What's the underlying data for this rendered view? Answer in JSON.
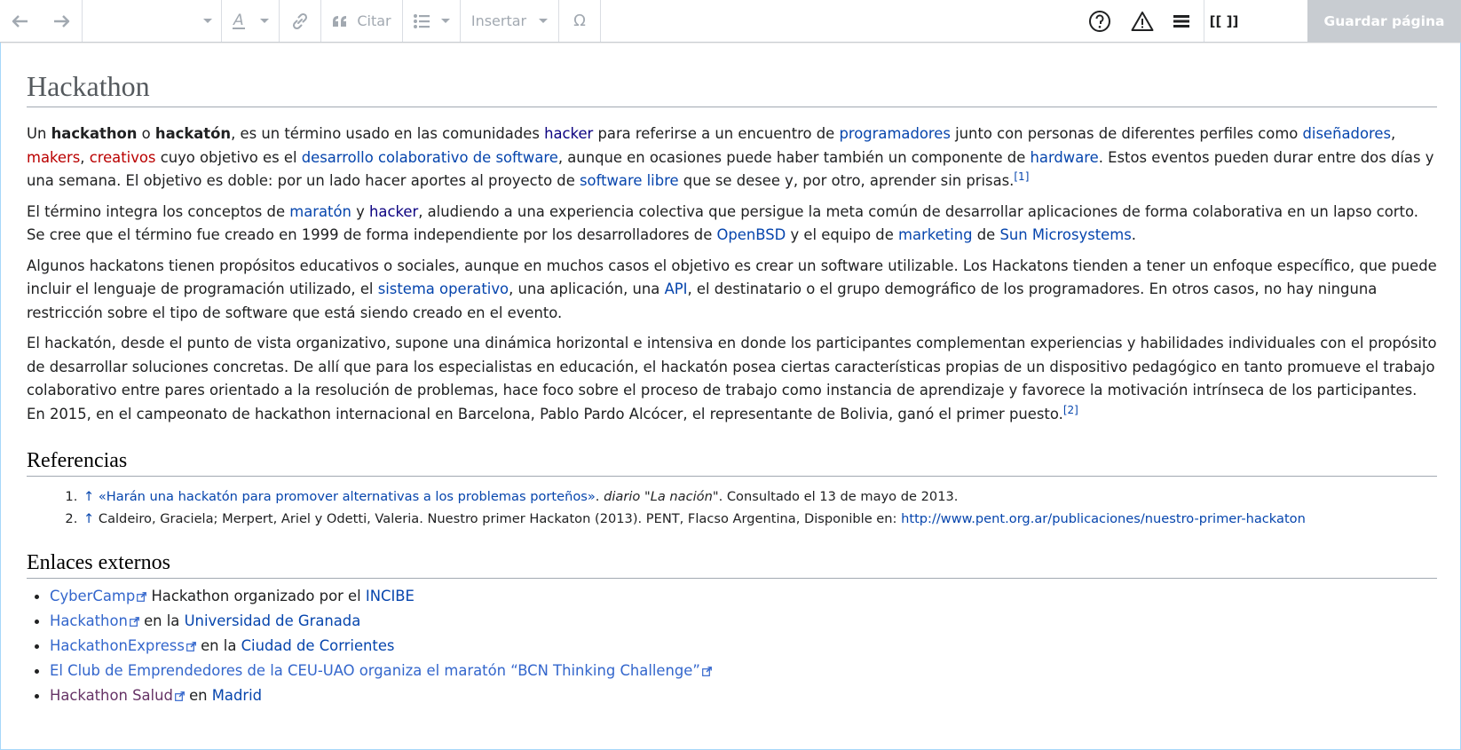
{
  "toolbar": {
    "undo_icon": "undo-icon",
    "redo_icon": "redo-icon",
    "format_select_value": "",
    "style_icon": "text-style-icon",
    "link_icon": "link-icon",
    "cite_label": "Citar",
    "list_icon": "bullet-list-icon",
    "insert_label": "Insertar",
    "special_char_label": "Ω",
    "help_icon": "help-icon",
    "notices_icon": "alert-icon",
    "menu_icon": "hamburger-menu-icon",
    "source_label": "[[ ]]",
    "save_label": "Guardar página"
  },
  "page": {
    "title": "Hackathon",
    "p1": {
      "t1": "Un ",
      "b1": "hackathon",
      "t2": " o ",
      "b2": "hackatón",
      "t3": ", es un término usado en las comunidades ",
      "l_hacker": "hacker",
      "t4": " para referirse a un encuentro de ",
      "l_programadores": "programadores",
      "t5": " junto con personas de diferentes perfiles como ",
      "l_disenadores": "diseñadores",
      "t6": ", ",
      "l_makers": "makers",
      "t7": ", ",
      "l_creativos": "creativos",
      "t8": " cuyo objetivo es el ",
      "l_desarrollo": "desarrollo colaborativo de software",
      "t9": ", aunque en ocasiones puede haber también un componente de ",
      "l_hardware": "hardware",
      "t10": ". Estos eventos pueden durar entre dos días y una semana. El objetivo es doble: por un lado hacer aportes al proyecto de ",
      "l_software_libre": "software libre",
      "t11": " que se desee y, por otro, aprender sin prisas.",
      "ref": "[1]"
    },
    "p2": {
      "t1": "El término integra los conceptos de ",
      "l_maraton": "maratón",
      "t2": " y ",
      "l_hacker": "hacker",
      "t3": ", aludiendo a una experiencia colectiva que persigue la meta común de desarrollar aplicaciones de forma colaborativa en un lapso corto. Se cree que el término fue creado en 1999 de forma independiente por los desarrolladores de ",
      "l_openbsd": "OpenBSD",
      "t4": " y el equipo de ",
      "l_marketing": "marketing",
      "t5": " de ",
      "l_sun": "Sun Microsystems",
      "t6": "."
    },
    "p3": {
      "t1": "Algunos hackatons tienen propósitos educativos o sociales, aunque en muchos casos el objetivo es crear un software utilizable. Los Hackatons tienden a tener un enfoque específico, que puede incluir el lenguaje de programación utilizado, el ",
      "l_so": "sistema operativo",
      "t2": ", una aplicación, una ",
      "l_api": "API",
      "t3": ", el destinatario o el grupo demográfico de los programadores. En otros casos, no hay ninguna restricción sobre el tipo de software que está siendo creado en el evento."
    },
    "p4": {
      "t1": "El hackatón, desde el punto de vista organizativo, supone una dinámica horizontal e intensiva en donde los participantes complementan experiencias y habilidades individuales con el propósito de desarrollar soluciones concretas. De allí que para los especialistas en educación, el hackatón posea ciertas características propias de un dispositivo pedagógico en tanto promueve el trabajo colaborativo entre pares orientado a la resolución de problemas, hace foco sobre el proceso de trabajo como instancia de aprendizaje y favorece la motivación intrínseca de los participantes. En 2015, en el campeonato de hackathon internacional en Barcelona, Pablo Pardo Alcócer, el representante de Bolivia, ganó el primer puesto.",
      "ref": "[2]"
    },
    "references": {
      "heading": "Referencias",
      "items": [
        {
          "arrow": "↑",
          "link": "«Harán una hackatón para promover alternativas a los problemas porteños»",
          "t1": ". ",
          "italic1": "diario",
          "t2": " \"",
          "italic2": "La nación",
          "t3": "\". Consultado el 13 de mayo de 2013."
        },
        {
          "arrow": "↑",
          "text": " Caldeiro, Graciela; Merpert, Ariel y Odetti, Valeria. Nuestro primer Hackaton (2013). PENT, Flacso Argentina, Disponible en: ",
          "link": "http://www.pent.org.ar/publicaciones/nuestro-primer-hackaton"
        }
      ]
    },
    "external": {
      "heading": "Enlaces externos",
      "items": [
        {
          "link": "CyberCamp",
          "text": " Hackathon organizado por el ",
          "link2": "INCIBE"
        },
        {
          "link": "Hackathon",
          "text": " en la ",
          "link2": "Universidad de Granada"
        },
        {
          "link": "HackathonExpress",
          "text": " en la ",
          "link2": "Ciudad de Corrientes"
        },
        {
          "link": "El Club de Emprendedores de la CEU-UAO organiza el maratón “BCN Thinking Challenge”",
          "text": "",
          "link2": ""
        },
        {
          "link": "Hackathon Salud",
          "text": " en ",
          "link2": "Madrid"
        }
      ]
    }
  }
}
